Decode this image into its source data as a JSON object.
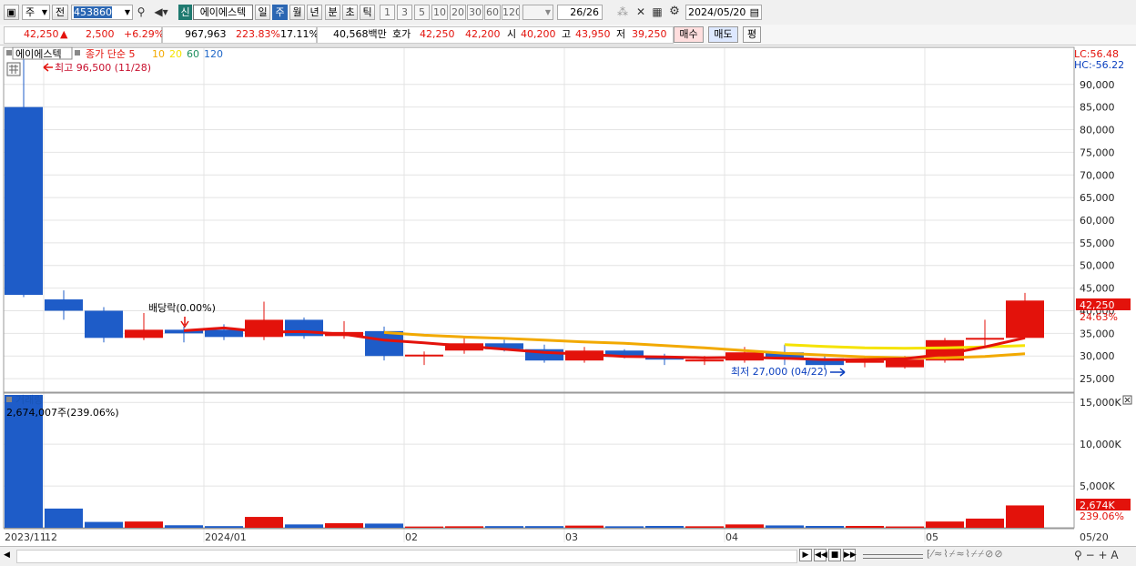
{
  "toolbar": {
    "market": "주",
    "prev": "전",
    "code": "453860",
    "new_badge": "신",
    "stock_name": "에이에스텍",
    "periods": [
      "일",
      "주",
      "월",
      "년",
      "분",
      "초",
      "틱"
    ],
    "active_period": "주",
    "intervals": [
      "1",
      "3",
      "5",
      "10",
      "20",
      "30",
      "60",
      "120"
    ],
    "count": "26",
    "count_total": "/26",
    "date": "2024/05/20"
  },
  "quote": {
    "price": "42,250",
    "change": "2,500",
    "change_arrow": "▲",
    "change_pct": "+6.29%",
    "volume": "967,963",
    "volume_ratio": "223.83%",
    "turnover": "17.11%",
    "amount": "40,568백만",
    "ask_label": "호가",
    "ask": "42,250",
    "bid": "42,200",
    "open_label": "시",
    "open": "40,200",
    "high_label": "고",
    "high": "43,950",
    "low_label": "저",
    "low": "39,250",
    "buy_label": "매수",
    "sell_label": "매도",
    "avg_label": "평"
  },
  "chart_data": {
    "type": "candlestick",
    "price_panel": {
      "title": "에이에스텍",
      "legend_prefix": "종가 단순",
      "ma_periods": [
        {
          "label": "5",
          "color": "#e3120b"
        },
        {
          "label": "10",
          "color": "#f2a900"
        },
        {
          "label": "20",
          "color": "#f5e300"
        },
        {
          "label": "60",
          "color": "#1f8f5f"
        },
        {
          "label": "120",
          "color": "#1e66c8"
        }
      ],
      "ylim": [
        22000,
        98000
      ],
      "y_ticks": [
        "90,000",
        "85,000",
        "80,000",
        "75,000",
        "70,000",
        "65,000",
        "60,000",
        "55,000",
        "50,000",
        "45,000",
        "40,000",
        "35,000",
        "30,000",
        "25,000"
      ],
      "y_tick_values": [
        90000,
        85000,
        80000,
        75000,
        70000,
        65000,
        60000,
        55000,
        50000,
        45000,
        40000,
        35000,
        30000,
        25000
      ],
      "lc": "LC:56.48",
      "hc": "HC:-56.22",
      "current_price_label": "42,250",
      "current_pct_label": "24.63%",
      "annotations": {
        "high": "최고 96,500 (11/28)",
        "low": "최저 27,000 (04/22)",
        "dividend": "배당락(0.00%)"
      }
    },
    "candles": [
      {
        "o": 85000,
        "h": 96500,
        "l": 43000,
        "c": 43500
      },
      {
        "o": 42500,
        "h": 44500,
        "l": 38000,
        "c": 40000
      },
      {
        "o": 40000,
        "h": 40800,
        "l": 33000,
        "c": 34000
      },
      {
        "o": 34000,
        "h": 39500,
        "l": 33500,
        "c": 35800
      },
      {
        "o": 35800,
        "h": 36500,
        "l": 33000,
        "c": 35000
      },
      {
        "o": 35800,
        "h": 37000,
        "l": 33500,
        "c": 34200
      },
      {
        "o": 34200,
        "h": 42000,
        "l": 33500,
        "c": 38000
      },
      {
        "o": 38000,
        "h": 38500,
        "l": 33800,
        "c": 34400
      },
      {
        "o": 34400,
        "h": 37700,
        "l": 33800,
        "c": 35300
      },
      {
        "o": 35500,
        "h": 36500,
        "l": 29000,
        "c": 30000
      },
      {
        "o": 30000,
        "h": 31000,
        "l": 28000,
        "c": 30300
      },
      {
        "o": 31200,
        "h": 34000,
        "l": 30500,
        "c": 32800
      },
      {
        "o": 32800,
        "h": 33600,
        "l": 31000,
        "c": 31500
      },
      {
        "o": 31500,
        "h": 32500,
        "l": 28500,
        "c": 29000
      },
      {
        "o": 29000,
        "h": 32000,
        "l": 28500,
        "c": 31200
      },
      {
        "o": 31200,
        "h": 31500,
        "l": 29500,
        "c": 29800
      },
      {
        "o": 29800,
        "h": 30500,
        "l": 28000,
        "c": 29200
      },
      {
        "o": 29200,
        "h": 30000,
        "l": 28000,
        "c": 29200
      },
      {
        "o": 29000,
        "h": 32000,
        "l": 28500,
        "c": 30800
      },
      {
        "o": 30800,
        "h": 32500,
        "l": 28000,
        "c": 29500
      },
      {
        "o": 29500,
        "h": 30000,
        "l": 27000,
        "c": 28000
      },
      {
        "o": 28500,
        "h": 30000,
        "l": 27500,
        "c": 29000
      },
      {
        "o": 27500,
        "h": 30000,
        "l": 27200,
        "c": 29200
      },
      {
        "o": 29000,
        "h": 34000,
        "l": 28500,
        "c": 33500
      },
      {
        "o": 34000,
        "h": 38000,
        "l": 32000,
        "c": 34000
      },
      {
        "o": 34000,
        "h": 43950,
        "l": 34000,
        "c": 42250
      }
    ],
    "ma_lines": [
      {
        "period": "5",
        "color": "#e3120b",
        "start": 4,
        "values": [
          35600,
          36200,
          35300,
          35400,
          34800,
          33500,
          32900,
          32200,
          31500,
          30800,
          30400,
          29900,
          29800,
          29600,
          29700,
          29500,
          29200,
          29200,
          29400,
          30400,
          32000,
          34000
        ]
      },
      {
        "period": "10",
        "color": "#f2a900",
        "start": 9,
        "values": [
          35200,
          34600,
          34200,
          33900,
          33500,
          33100,
          32800,
          32300,
          31800,
          31200,
          30600,
          30200,
          29800,
          29600,
          29600,
          29900,
          30500
        ]
      },
      {
        "period": "20",
        "color": "#f5e300",
        "start": 19,
        "values": [
          32500,
          32100,
          31800,
          31700,
          31800,
          32000,
          32300
        ]
      }
    ],
    "volume_panel": {
      "title": "거래량",
      "header": "2,674,007주(239.06%)",
      "ylim": [
        0,
        16000
      ],
      "y_ticks": [
        "15,000K",
        "10,000K",
        "5,000K"
      ],
      "y_tick_values": [
        15000,
        10000,
        5000
      ],
      "current_label": "2,674K",
      "current_pct": "239.06%",
      "values_k": [
        17000,
        2300,
        700,
        750,
        300,
        200,
        1300,
        400,
        550,
        500,
        150,
        180,
        200,
        200,
        260,
        180,
        220,
        180,
        400,
        280,
        220,
        220,
        160,
        750,
        1100,
        2674
      ]
    },
    "x_labels": [
      {
        "index": 0,
        "text": "2023/11"
      },
      {
        "index": 1,
        "text": "12"
      },
      {
        "index": 5,
        "text": "2024/01"
      },
      {
        "index": 10,
        "text": "02"
      },
      {
        "index": 14,
        "text": "03"
      },
      {
        "index": 18,
        "text": "04"
      },
      {
        "index": 23,
        "text": "05"
      }
    ],
    "x_end_label": "05/20"
  },
  "colors": {
    "up": "#e3120b",
    "down": "#1e5cc8"
  }
}
